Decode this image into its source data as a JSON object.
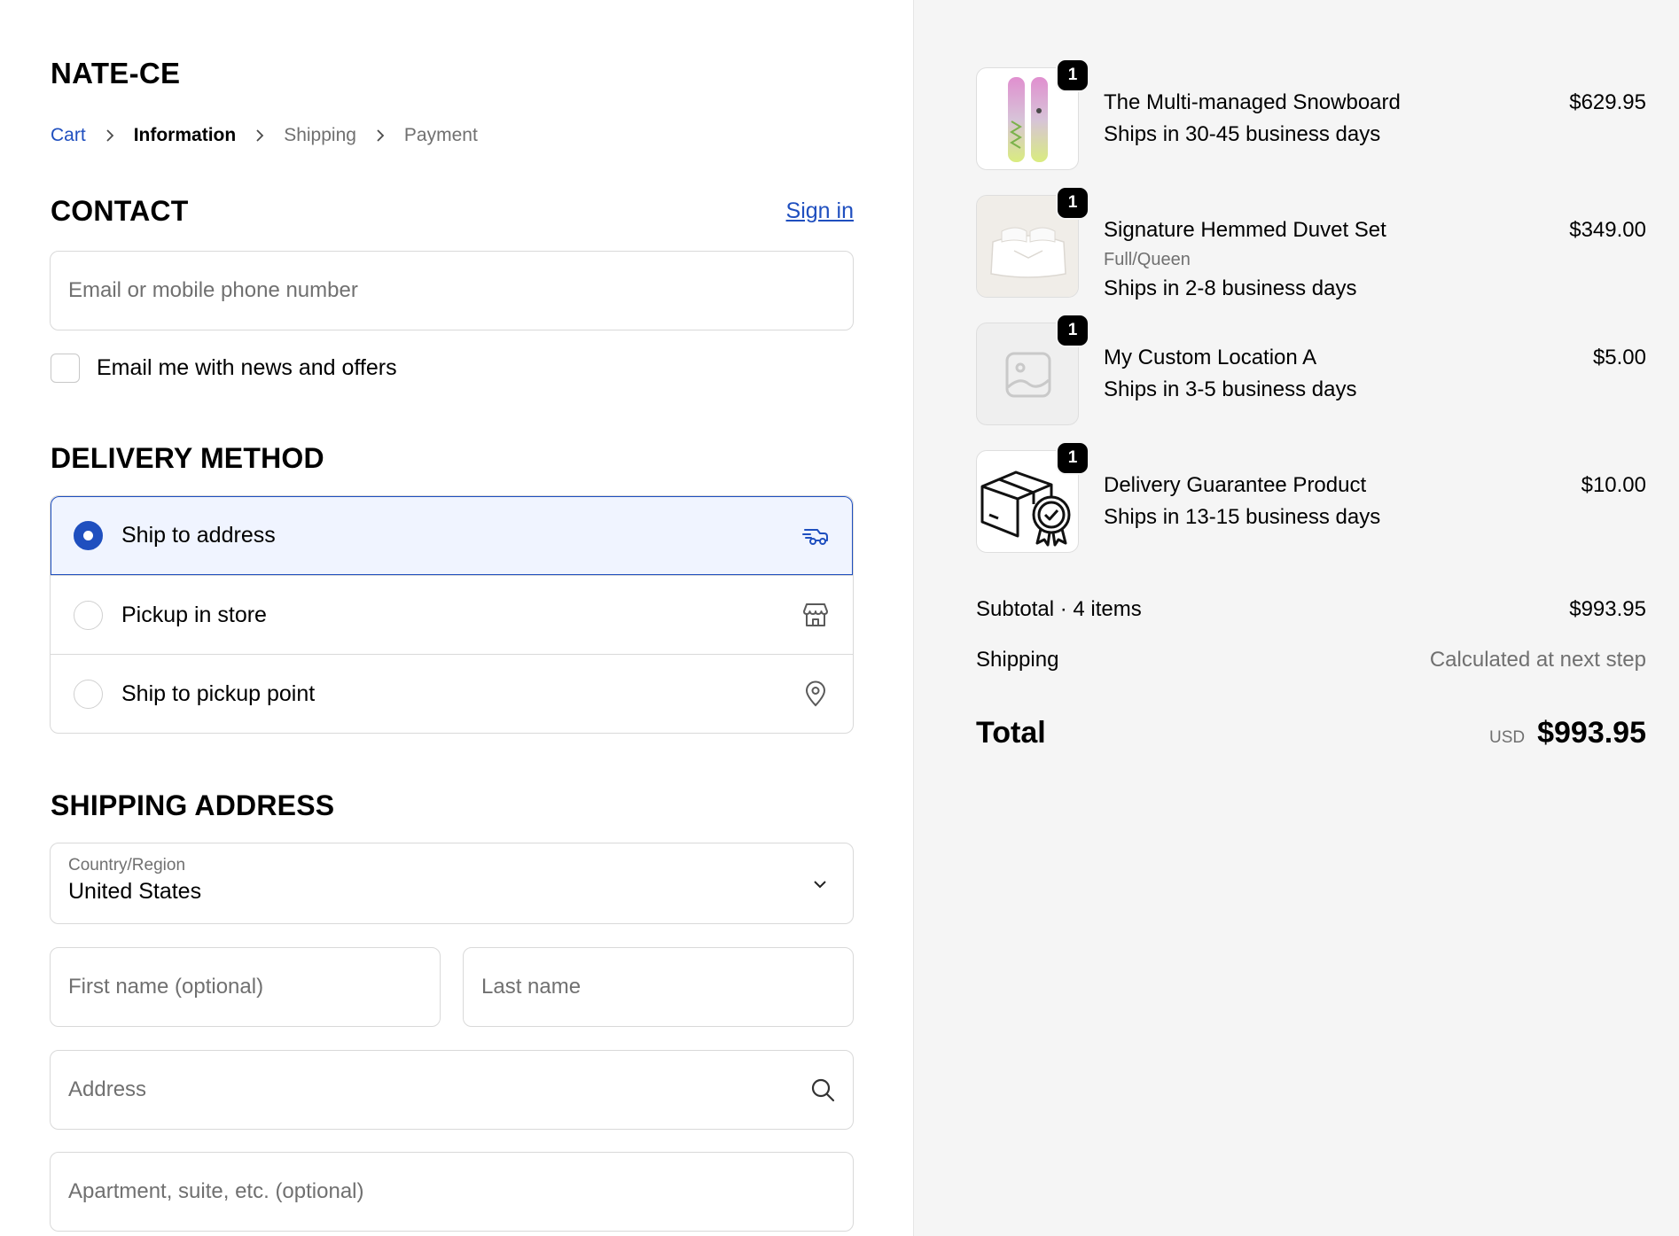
{
  "store": {
    "name": "NATE-CE"
  },
  "breadcrumb": {
    "cart": "Cart",
    "information": "Information",
    "shipping": "Shipping",
    "payment": "Payment"
  },
  "contact": {
    "title": "CONTACT",
    "sign_in": "Sign in",
    "email_placeholder": "Email or mobile phone number",
    "newsletter_label": "Email me with news and offers",
    "newsletter_checked": false
  },
  "delivery": {
    "title": "DELIVERY METHOD",
    "options": [
      {
        "label": "Ship to address",
        "selected": true,
        "icon": "truck-icon"
      },
      {
        "label": "Pickup in store",
        "selected": false,
        "icon": "store-icon"
      },
      {
        "label": "Ship to pickup point",
        "selected": false,
        "icon": "location-pin-icon"
      }
    ]
  },
  "shipping_address": {
    "title": "SHIPPING ADDRESS",
    "country_label": "Country/Region",
    "country_value": "United States",
    "first_name_placeholder": "First name (optional)",
    "last_name_placeholder": "Last name",
    "address_placeholder": "Address",
    "apartment_placeholder": "Apartment, suite, etc. (optional)"
  },
  "order": {
    "items": [
      {
        "name": "The Multi-managed Snowboard",
        "variant": "",
        "shipping": "Ships in 30-45 business days",
        "price": "$629.95",
        "qty": "1",
        "image": "snowboard-image"
      },
      {
        "name": "Signature Hemmed Duvet Set",
        "variant": "Full/Queen",
        "shipping": "Ships in 2-8 business days",
        "price": "$349.00",
        "qty": "1",
        "image": "duvet-image"
      },
      {
        "name": "My Custom Location A",
        "variant": "",
        "shipping": "Ships in 3-5 business days",
        "price": "$5.00",
        "qty": "1",
        "image": "placeholder-image-icon"
      },
      {
        "name": "Delivery Guarantee Product",
        "variant": "",
        "shipping": "Ships in 13-15 business days",
        "price": "$10.00",
        "qty": "1",
        "image": "guarantee-box-icon"
      }
    ],
    "subtotal_label": "Subtotal · 4 items",
    "subtotal_value": "$993.95",
    "shipping_label": "Shipping",
    "shipping_value": "Calculated at next step",
    "total_label": "Total",
    "currency": "USD",
    "total_value": "$993.95"
  },
  "colors": {
    "accent": "#1f4fbf",
    "selected_bg": "#f0f4ff",
    "summary_bg": "#f5f5f5",
    "muted_text": "#707070"
  }
}
